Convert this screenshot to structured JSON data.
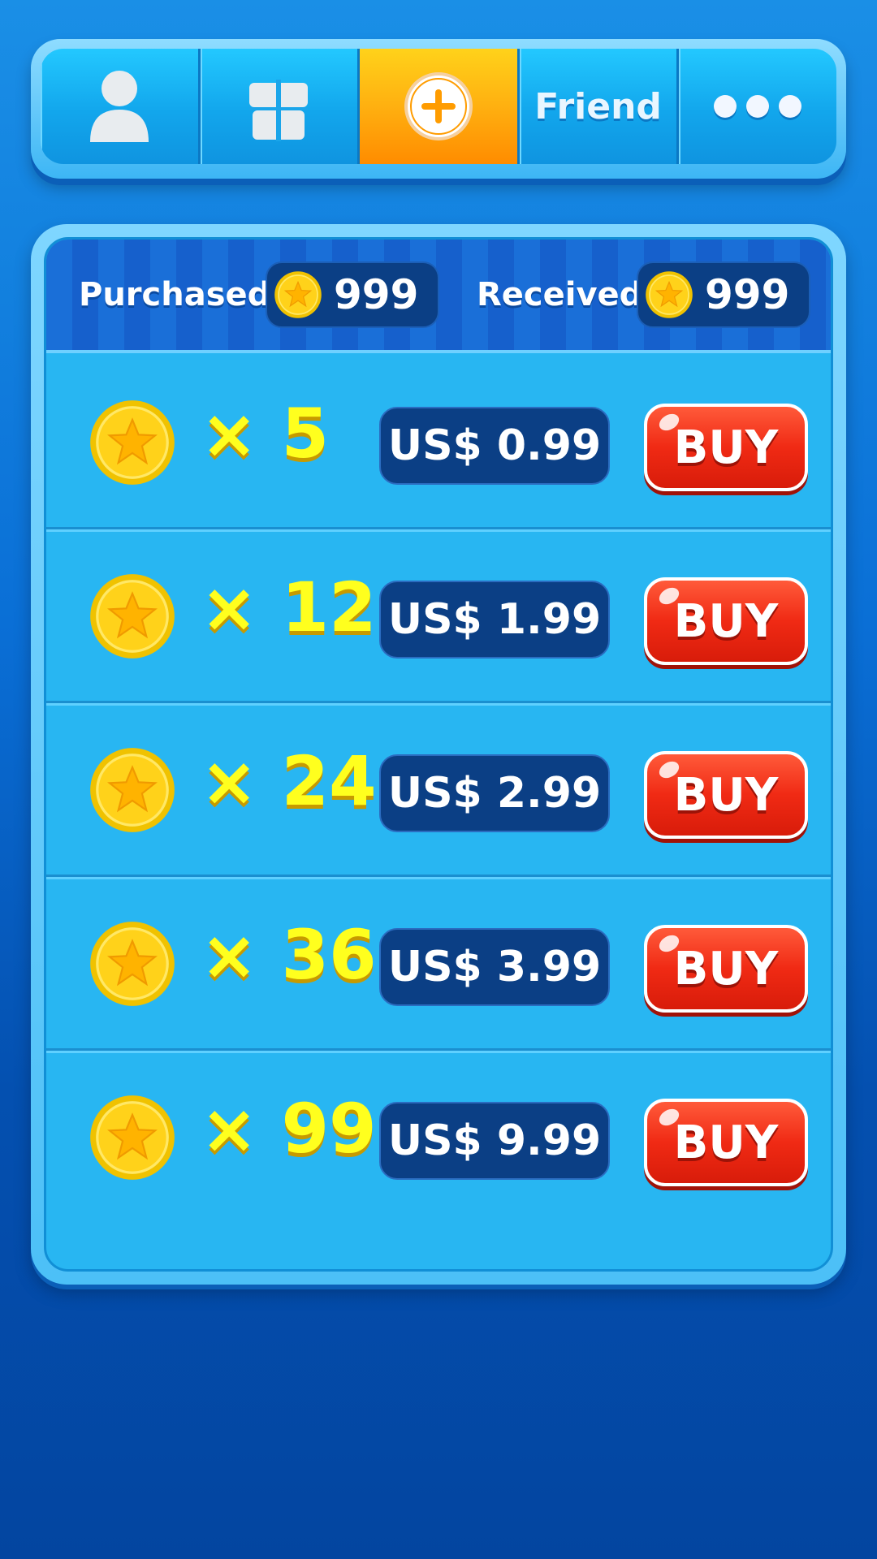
{
  "tabs": [
    {
      "name": "profile",
      "icon": "person-icon",
      "label": ""
    },
    {
      "name": "gift",
      "icon": "gift-icon",
      "label": ""
    },
    {
      "name": "add-coins",
      "icon": "plus-circle-icon",
      "label": "",
      "active": true
    },
    {
      "name": "friend",
      "icon": "",
      "label": "Friend"
    },
    {
      "name": "more",
      "icon": "more-dots-icon",
      "label": ""
    }
  ],
  "balance": {
    "purchased_label": "Purchased",
    "purchased_value": "999",
    "received_label": "Received",
    "received_value": "999"
  },
  "offers": [
    {
      "quantity": "× 5",
      "price": "US$ 0.99",
      "buy_label": "BUY"
    },
    {
      "quantity": "× 12",
      "price": "US$ 1.99",
      "buy_label": "BUY"
    },
    {
      "quantity": "× 24",
      "price": "US$ 2.99",
      "buy_label": "BUY"
    },
    {
      "quantity": "× 36",
      "price": "US$ 3.99",
      "buy_label": "BUY"
    },
    {
      "quantity": "× 99",
      "price": "US$ 9.99",
      "buy_label": "BUY"
    }
  ],
  "colors": {
    "accent_orange": "#ff9c00",
    "buy_red": "#f02a14",
    "coin_gold": "#ffd21a",
    "panel_blue": "#28b6f2",
    "badge_navy": "#0b3f85"
  }
}
